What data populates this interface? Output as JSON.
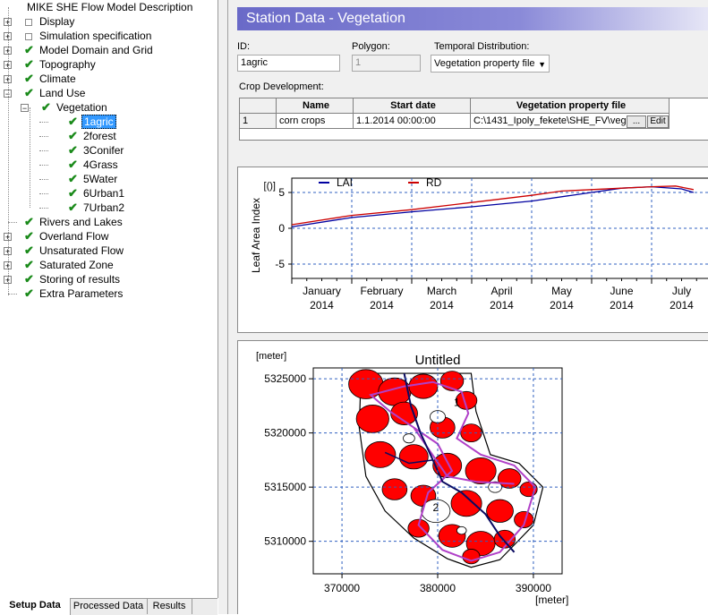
{
  "tree": {
    "items": [
      {
        "label": "MIKE SHE Flow Model Description",
        "level": 0,
        "expander": "",
        "mark": "none"
      },
      {
        "label": "Display",
        "level": 0,
        "expander": "+",
        "mark": "box"
      },
      {
        "label": "Simulation specification",
        "level": 0,
        "expander": "+",
        "mark": "box"
      },
      {
        "label": "Model Domain and Grid",
        "level": 0,
        "expander": "+",
        "mark": "check"
      },
      {
        "label": "Topography",
        "level": 0,
        "expander": "+",
        "mark": "check"
      },
      {
        "label": "Climate",
        "level": 0,
        "expander": "+",
        "mark": "check"
      },
      {
        "label": "Land Use",
        "level": 0,
        "expander": "-",
        "mark": "check"
      },
      {
        "label": "Vegetation",
        "level": 1,
        "expander": "-",
        "mark": "check"
      },
      {
        "label": "1agric",
        "level": 2,
        "expander": "",
        "mark": "check",
        "selected": true
      },
      {
        "label": "2forest",
        "level": 2,
        "expander": "",
        "mark": "check"
      },
      {
        "label": "3Conifer",
        "level": 2,
        "expander": "",
        "mark": "check"
      },
      {
        "label": "4Grass",
        "level": 2,
        "expander": "",
        "mark": "check"
      },
      {
        "label": "5Water",
        "level": 2,
        "expander": "",
        "mark": "check"
      },
      {
        "label": "6Urban1",
        "level": 2,
        "expander": "",
        "mark": "check"
      },
      {
        "label": "7Urban2",
        "level": 2,
        "expander": "",
        "mark": "check"
      },
      {
        "label": "Rivers and Lakes",
        "level": 0,
        "expander": "",
        "mark": "check"
      },
      {
        "label": "Overland Flow",
        "level": 0,
        "expander": "+",
        "mark": "check"
      },
      {
        "label": "Unsaturated Flow",
        "level": 0,
        "expander": "+",
        "mark": "check"
      },
      {
        "label": "Saturated Zone",
        "level": 0,
        "expander": "+",
        "mark": "check"
      },
      {
        "label": "Storing of results",
        "level": 0,
        "expander": "+",
        "mark": "check"
      },
      {
        "label": "Extra Parameters",
        "level": 0,
        "expander": "",
        "mark": "check"
      }
    ]
  },
  "tabs": [
    {
      "label": "Setup Data",
      "active": true
    },
    {
      "label": "Processed Data",
      "active": false
    },
    {
      "label": "Results",
      "active": false
    }
  ],
  "station": {
    "title": "Station Data - Vegetation",
    "id_label": "ID:",
    "id_value": "1agric",
    "polygon_label": "Polygon:",
    "polygon_value": "1",
    "temporal_label": "Temporal Distribution:",
    "temporal_value": "Vegetation property file",
    "crop_label": "Crop Development:",
    "grid": {
      "headers": [
        "",
        "Name",
        "Start date",
        "Vegetation property file"
      ],
      "rows": [
        [
          "1",
          "corn crops",
          "1.1.2014 00:00:00",
          "C:\\1431_Ipoly_fekete\\SHE_FV\\veg"
        ]
      ],
      "browse_label": "...",
      "edit_label": "Edit"
    }
  },
  "chart_data": [
    {
      "type": "line",
      "title": "",
      "ylabel": "Leaf Area Index",
      "yunit": "[()]",
      "ylim": [
        -7,
        7
      ],
      "yticks": [
        -5,
        0,
        5
      ],
      "x_labels": [
        {
          "month": "January",
          "year": "2014"
        },
        {
          "month": "February",
          "year": "2014"
        },
        {
          "month": "March",
          "year": "2014"
        },
        {
          "month": "April",
          "year": "2014"
        },
        {
          "month": "May",
          "year": "2014"
        },
        {
          "month": "June",
          "year": "2014"
        },
        {
          "month": "July",
          "year": "2014"
        }
      ],
      "legend_position": "top",
      "grid": true,
      "series": [
        {
          "name": "LAI",
          "color": "#0000a0",
          "x": [
            0,
            1,
            2,
            3,
            4,
            5,
            5.5,
            6,
            6.5,
            6.7
          ],
          "values": [
            0.2,
            1.5,
            2.3,
            3.0,
            3.8,
            5.0,
            5.6,
            5.8,
            5.5,
            5.0
          ]
        },
        {
          "name": "RD",
          "color": "#cc0000",
          "x": [
            0,
            1,
            2,
            3,
            4,
            4.5,
            5,
            5.5,
            6,
            6.4,
            6.7
          ],
          "values": [
            0.5,
            1.8,
            2.6,
            3.6,
            4.6,
            5.2,
            5.4,
            5.6,
            5.8,
            5.9,
            5.4
          ]
        }
      ]
    },
    {
      "type": "map",
      "title": "Untitled",
      "xunit": "[meter]",
      "yunit": "[meter]",
      "xticks": [
        370000,
        380000,
        390000
      ],
      "yticks": [
        5310000,
        5315000,
        5320000,
        5325000
      ],
      "xlim": [
        367000,
        393000
      ],
      "ylim": [
        5307000,
        5326000
      ],
      "grid": true,
      "fill_color": "#ff0000",
      "boundary_color": "#b040c8",
      "zone_labels": [
        {
          "text": "1",
          "x": 382000,
          "y": 5322500
        },
        {
          "text": "2",
          "x": 379800,
          "y": 5312800
        }
      ]
    }
  ]
}
